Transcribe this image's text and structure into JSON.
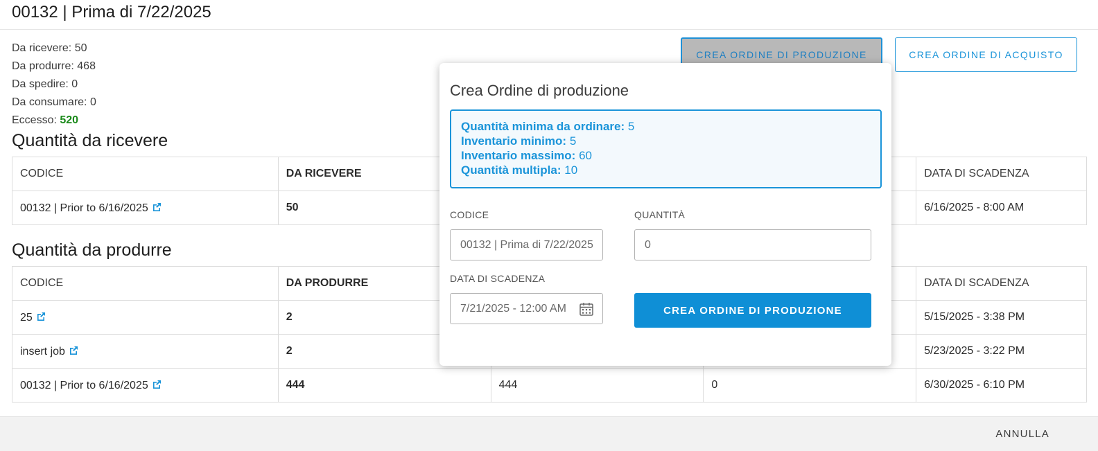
{
  "header": {
    "title": "00132 | Prima di 7/22/2025"
  },
  "summary": {
    "to_receive": "Da ricevere: 50",
    "to_produce": "Da produrre: 468",
    "to_ship": "Da spedire: 0",
    "to_consume": "Da consumare: 0",
    "excess_label": "Eccesso: ",
    "excess_value": "520"
  },
  "top_buttons": {
    "create_production": "CREA ORDINE DI PRODUZIONE",
    "create_purchase": "CREA ORDINE DI ACQUISTO"
  },
  "receive_section": {
    "title": "Quantità da ricevere",
    "headers": [
      "CODICE",
      "DA RICEVERE",
      "",
      "",
      "DATA DI SCADENZA"
    ],
    "rows": [
      {
        "code": "00132 | Prior to 6/16/2025",
        "qty": "50",
        "c3": "",
        "c4": "",
        "date": "6/16/2025 - 8:00 AM"
      }
    ]
  },
  "produce_section": {
    "title": "Quantità da produrre",
    "headers": [
      "CODICE",
      "DA PRODURRE",
      "",
      "",
      "DATA DI SCADENZA"
    ],
    "rows": [
      {
        "code": "25",
        "qty": "2",
        "c3": "",
        "c4": "",
        "date": "5/15/2025 - 3:38 PM"
      },
      {
        "code": "insert job",
        "qty": "2",
        "c3": "",
        "c4": "",
        "date": "5/23/2025 - 3:22 PM"
      },
      {
        "code": "00132 | Prior to 6/16/2025",
        "qty": "444",
        "c3": "444",
        "c4": "0",
        "date": "6/30/2025 - 6:10 PM"
      }
    ]
  },
  "popover": {
    "title": "Crea Ordine di produzione",
    "info": {
      "min_order_label": "Quantità minima da ordinare:",
      "min_order_value": "5",
      "min_inv_label": "Inventario minimo:",
      "min_inv_value": "5",
      "max_inv_label": "Inventario massimo:",
      "max_inv_value": "60",
      "multiple_label": "Quantità multipla:",
      "multiple_value": "10"
    },
    "code_label": "CODICE",
    "code_value": "00132 | Prima di 7/22/2025",
    "qty_label": "QUANTITÀ",
    "qty_placeholder": "0",
    "due_label": "DATA DI SCADENZA",
    "due_value": "7/21/2025 - 12:00 AM",
    "submit_label": "CREA ORDINE DI PRODUZIONE"
  },
  "footer": {
    "cancel_label": "ANNULLA"
  },
  "colors": {
    "accent": "#1a94d9",
    "excess": "#1a8a1a",
    "primary_button": "#0f8fd6"
  },
  "icons": {
    "external_link": "external-link-icon",
    "calendar": "calendar-icon"
  }
}
